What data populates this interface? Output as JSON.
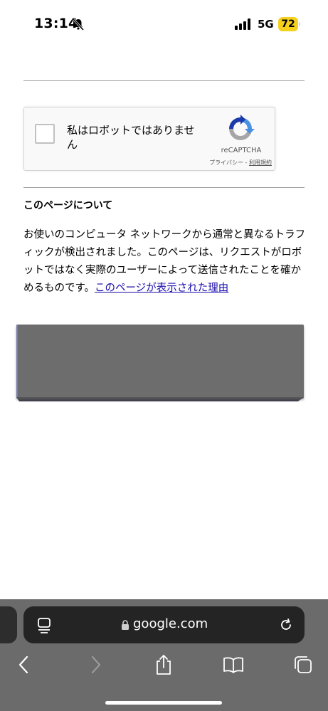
{
  "status_bar": {
    "time": "13:14",
    "network": "5G",
    "battery": "72"
  },
  "recaptcha": {
    "label": "私はロボットではありません",
    "brand": "reCAPTCHA",
    "privacy": "プライバシー",
    "separator": " - ",
    "terms": "利用規約"
  },
  "about": {
    "title": "このページについて",
    "body": "お使いのコンピュータ ネットワークから通常と異なるトラフィックが検出されました。このページは、リクエストがロボットではなく実際のユーザーによって送信されたことを確かめるものです。",
    "link": "このページが表示された理由"
  },
  "browser": {
    "url": "google.com"
  },
  "icons": [
    "bell-slash-icon",
    "signal-icon",
    "recaptcha-logo-icon",
    "reader-icon",
    "lock-icon",
    "reload-icon",
    "back-icon",
    "forward-icon",
    "share-icon",
    "bookmarks-icon",
    "tabs-icon"
  ]
}
